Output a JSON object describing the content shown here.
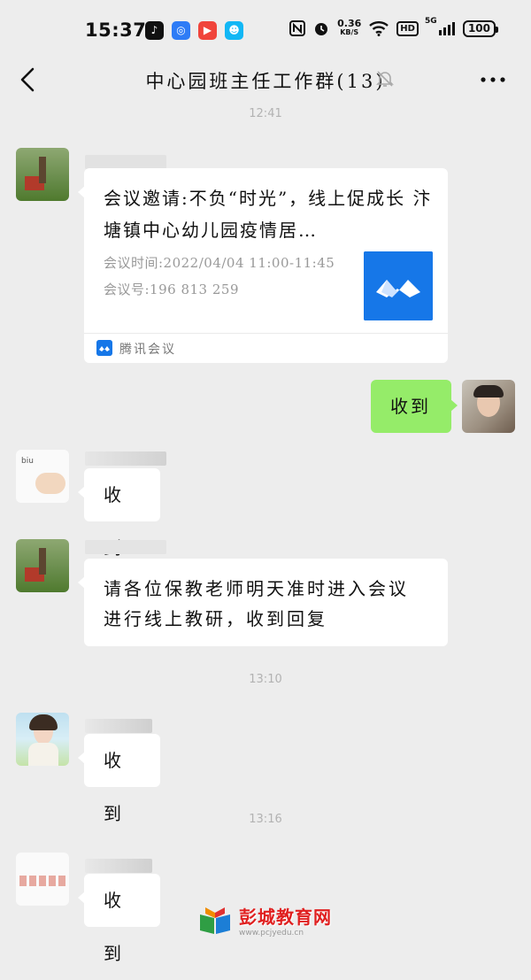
{
  "status_bar": {
    "time": "15:37",
    "net_speed_value": "0.36",
    "net_speed_unit": "KB/S",
    "hd": "HD",
    "signal": "5G",
    "battery": "100",
    "icons": [
      "tiktok-icon",
      "app-icon",
      "video-icon",
      "qq-icon",
      "nfc-icon",
      "alarm-icon",
      "wifi-icon",
      "signal-icon"
    ]
  },
  "header": {
    "title": "中心园班主任工作群(13)",
    "icons": [
      "back-icon",
      "mute-bell-icon",
      "more-icon"
    ]
  },
  "messages": {
    "t1": "12:41",
    "card": {
      "title": "会议邀请:不负“时光”，线上促成长 汴塘镇中心幼儿园疫情居…",
      "time_line": "会议时间:2022/04/04 11:00-11:45",
      "id_line": "会议号:196 813 259",
      "source": "腾讯会议"
    },
    "me_reply": "收到",
    "reply2": "收到",
    "notice": "请各位保教老师明天准时进入会议进行线上教研，收到回复",
    "t2": "13:10",
    "reply3": "收到",
    "t3": "13:16",
    "reply4": "收到"
  },
  "watermark": {
    "text": "彭城教育网",
    "url": "www.pcjyedu.cn"
  },
  "colors": {
    "background": "#ededed",
    "my_bubble": "#95ec69",
    "meeting_blue": "#1677e8"
  }
}
